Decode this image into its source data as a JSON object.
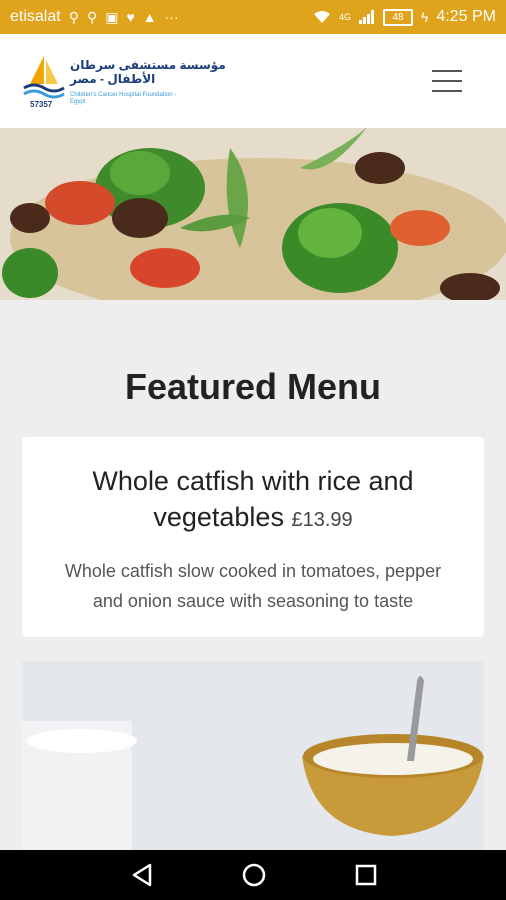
{
  "status_bar": {
    "carrier": "etisalat",
    "battery": "48",
    "time": "4:25 PM",
    "signal_label": "4G",
    "icons": [
      "usb-icon",
      "usb-icon",
      "app-icon",
      "heart-icon",
      "warning-icon",
      "more-icon",
      "wifi-icon",
      "signal-icon",
      "battery-icon",
      "charging-icon"
    ]
  },
  "header": {
    "logo_arabic_line1": "مؤسسة مستشفى سرطان",
    "logo_arabic_line2": "الأطفال - مصر",
    "logo_english": "Children's Cancer Hospital Foundation - Egypt",
    "logo_number": "57357",
    "menu_icon": "hamburger-menu-icon"
  },
  "hero": {
    "image": "vegetable-rice-dish-image"
  },
  "section": {
    "title": "Featured Menu"
  },
  "menu_item": {
    "title": "Whole catfish with rice and vegetables",
    "price": "£13.99",
    "description": "Whole catfish slow cooked in tomatoes, pepper and onion sauce with seasoning to taste"
  },
  "second_card": {
    "image": "bowl-of-yogurt-image"
  },
  "nav": {
    "back": "back-icon",
    "home": "home-icon",
    "recents": "recents-icon"
  },
  "colors": {
    "status_bar": "#e0a31c",
    "page_bg": "#eeeeee",
    "card_bg": "#ffffff",
    "logo_blue": "#1a3d7c",
    "logo_sail": "#f0a500"
  }
}
